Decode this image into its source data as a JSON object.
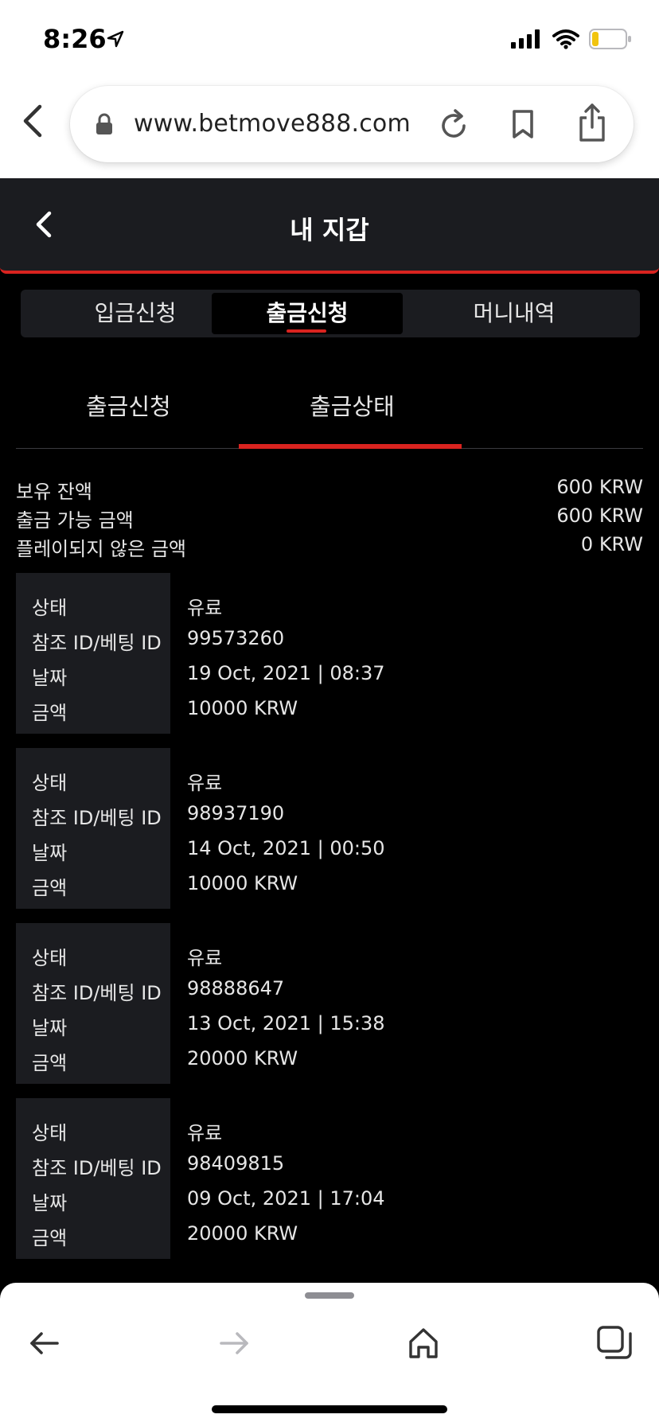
{
  "status": {
    "time": "8:26"
  },
  "browser": {
    "url": "www.betmove888.com"
  },
  "header": {
    "title": "내 지갑"
  },
  "top_tabs": [
    {
      "label": "입금신청"
    },
    {
      "label": "출금신청"
    },
    {
      "label": "머니내역"
    }
  ],
  "sub_tabs": [
    {
      "label": "출금신청"
    },
    {
      "label": "출금상태"
    }
  ],
  "balance": [
    {
      "label": "보유 잔액",
      "value": "600 KRW"
    },
    {
      "label": "출금 가능 금액",
      "value": "600 KRW"
    },
    {
      "label": "플레이되지 않은 금액",
      "value": "0 KRW"
    }
  ],
  "record_labels": {
    "status": "상태",
    "ref": "참조 ID/베팅 ID",
    "date": "날짜",
    "amount": "금액"
  },
  "records": [
    {
      "status": "유료",
      "ref": "99573260",
      "date": "19 Oct, 2021 | 08:37",
      "amount": "10000 KRW"
    },
    {
      "status": "유료",
      "ref": "98937190",
      "date": "14 Oct, 2021 | 00:50",
      "amount": "10000 KRW"
    },
    {
      "status": "유료",
      "ref": "98888647",
      "date": "13 Oct, 2021 | 15:38",
      "amount": "20000 KRW"
    },
    {
      "status": "유료",
      "ref": "98409815",
      "date": "09 Oct, 2021 | 17:04",
      "amount": "20000 KRW"
    }
  ],
  "colors": {
    "accent": "#d9231f",
    "panel": "#1b1c20",
    "background": "#000000"
  }
}
